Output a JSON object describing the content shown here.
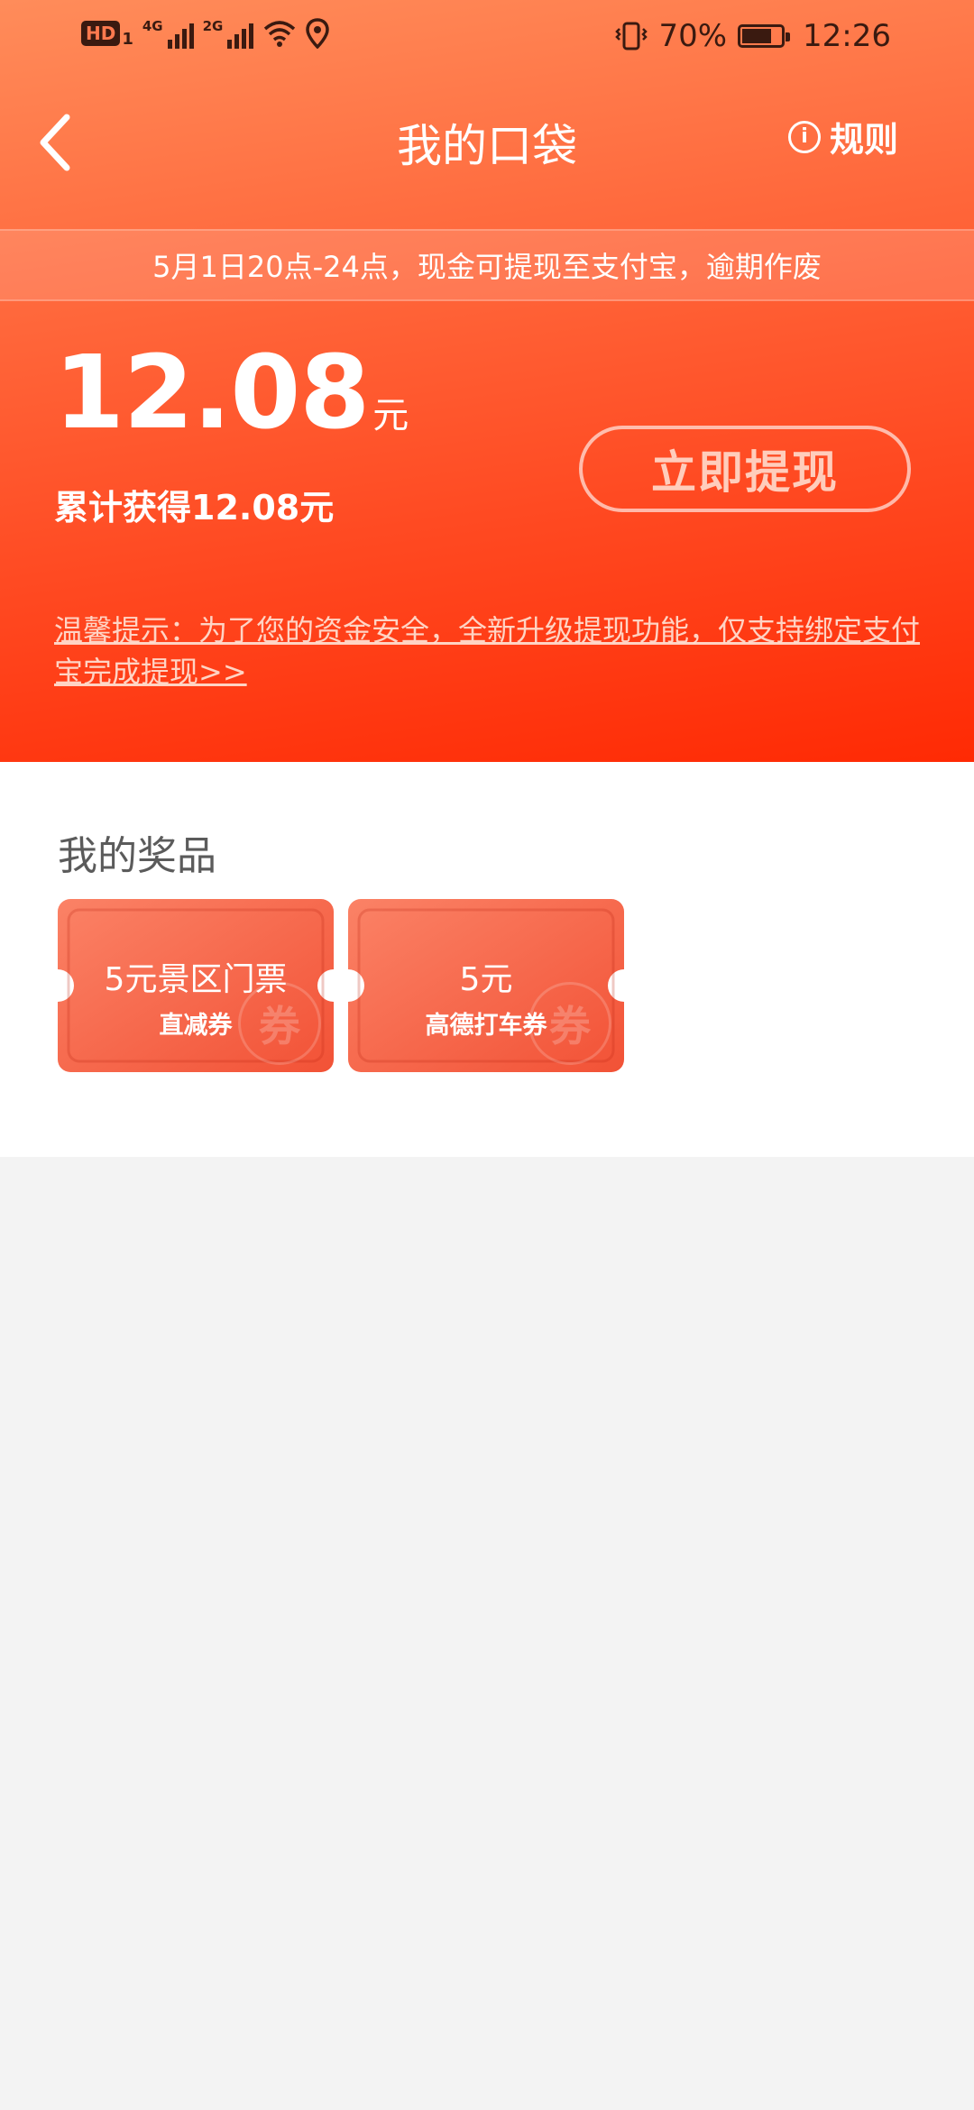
{
  "status_bar": {
    "hd": "HD",
    "sim1": "1",
    "net1": "4G",
    "net2": "2G",
    "battery_percent": "70%",
    "time": "12:26"
  },
  "nav": {
    "title": "我的口袋",
    "rules_label": "规则",
    "info_glyph": "i"
  },
  "notice": "5月1日20点-24点，现金可提现至支付宝，逾期作废",
  "wallet": {
    "balance": "12.08",
    "unit": "元",
    "cumulative": "累计获得12.08元",
    "withdraw_label": "立即提现",
    "tip": "温馨提示：为了您的资金安全，全新升级提现功能，仅支持绑定支付宝完成提现>>"
  },
  "prizes": {
    "title": "我的奖品",
    "items": [
      {
        "line1": "5元景区门票",
        "line2": "直减券",
        "watermark": "券"
      },
      {
        "line1": "5元",
        "line2": "高德打车券",
        "watermark": "券"
      }
    ]
  },
  "colors": {
    "header_gradient_start": "#ff8c5a",
    "header_gradient_end": "#ff2a04",
    "coupon": "#f6694c",
    "page_bg": "#f3f3f3"
  }
}
